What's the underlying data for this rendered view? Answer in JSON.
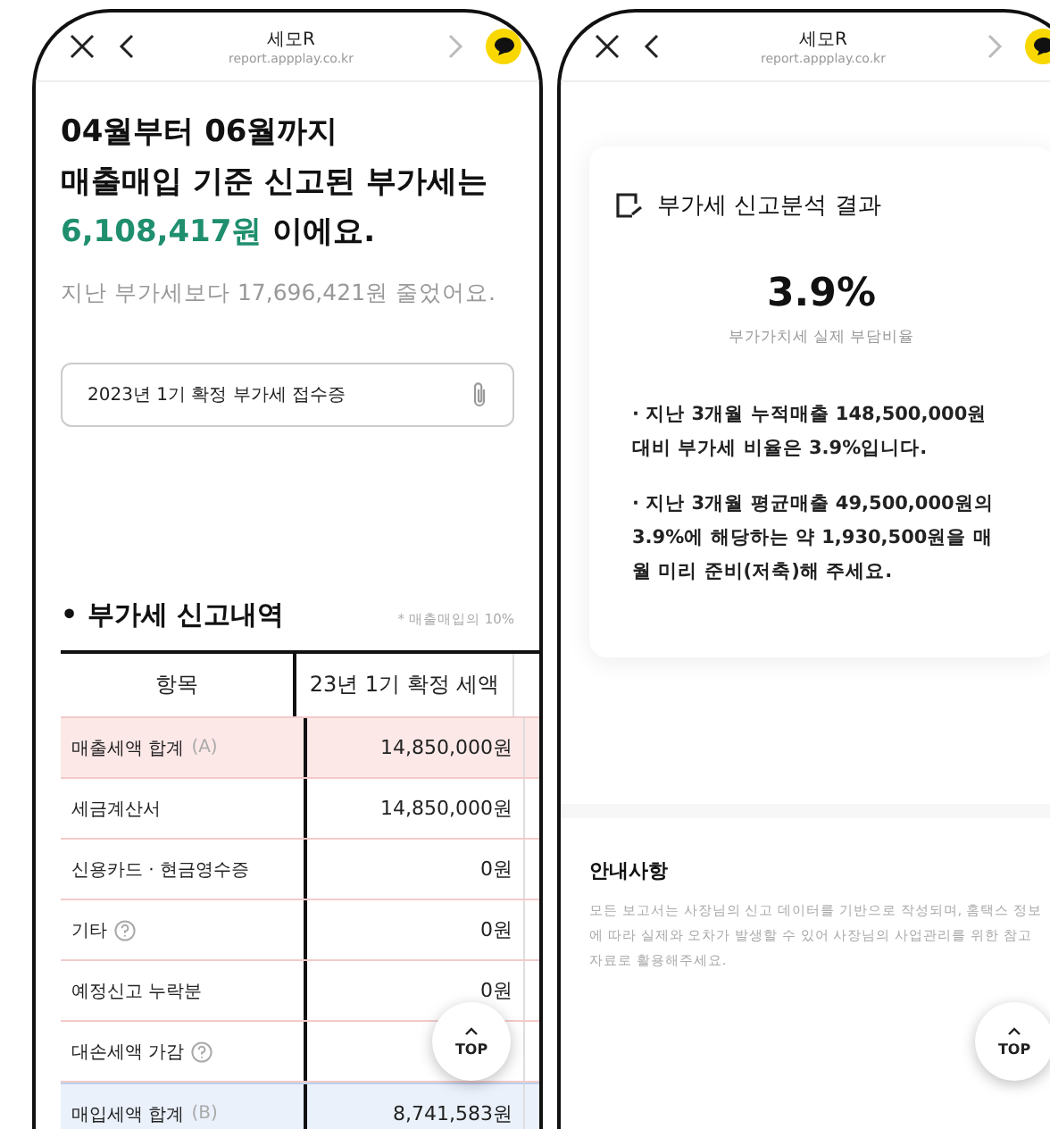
{
  "screens": [
    {
      "header": {
        "title": "세모R",
        "url": "report.appplay.co.kr"
      },
      "headline": [
        "04월부터 06월까지",
        "매출매입 기준 신고된 부가세는"
      ],
      "amount": "6,108,417원",
      "amount_suffix": " 이에요.",
      "comparison": "지난 부가세보다 17,696,421원 줄었어요.",
      "attachment": {
        "label": "2023년 1기 확정 부가세 접수증"
      },
      "section": {
        "title": "• 부가세 신고내역",
        "note": "* 매출매입의 10%"
      },
      "table": {
        "columns": [
          "항목",
          "23년 1기 확정 세액"
        ],
        "rows": [
          {
            "kind": "total",
            "label": "매출세액 합계",
            "tag": "(A)",
            "help": false,
            "value": "14,850,000원"
          },
          {
            "kind": "item",
            "label": "세금계산서",
            "help": false,
            "value": "14,850,000원"
          },
          {
            "kind": "item",
            "label": "신용카드 · 현금영수증",
            "help": false,
            "value": "0원"
          },
          {
            "kind": "item",
            "label": "기타",
            "help": true,
            "value": "0원"
          },
          {
            "kind": "item",
            "label": "예정신고 누락분",
            "help": false,
            "value": "0원"
          },
          {
            "kind": "item",
            "label": "대손세액 가감",
            "help": true
          },
          {
            "kind": "purchase",
            "label": "매입세액 합계",
            "tag": "(B)",
            "help": false,
            "value": "8,741,583원"
          }
        ]
      },
      "top_button": "TOP"
    },
    {
      "header": {
        "title": "세모R",
        "url": "report.appplay.co.kr"
      },
      "card": {
        "title": "부가세 신고분석 결과",
        "rate": "3.9%",
        "rate_label": "부가가치세 실제 부담비율",
        "bullets": [
          "· 지난 3개월 누적매출 148,500,000원 대비 부가세 비율은 3.9%입니다.",
          "· 지난 3개월 평균매출 49,500,000원의 3.9%에 해당하는 약 1,930,500원을 매월 미리 준비(저축)해 주세요."
        ]
      },
      "notice": {
        "title": "안내사항",
        "text": "모든 보고서는 사장님의 신고 데이터를 기반으로 작성되며, 홈택스 정보에 따라 실제와 오차가 발생할 수 있어 사장님의 사업관리를 위한 참고 자료로 활용해주세요."
      },
      "top_button": "TOP"
    }
  ]
}
